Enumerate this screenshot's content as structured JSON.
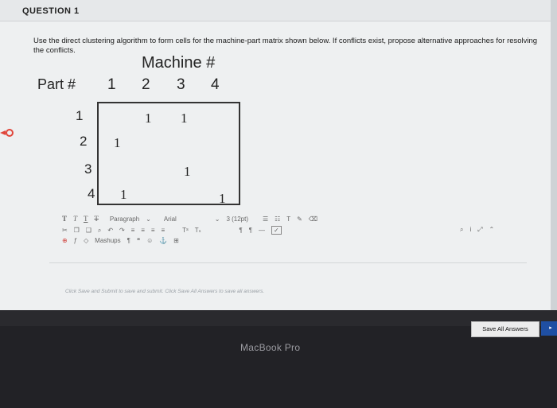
{
  "question": {
    "title": "QUESTION 1",
    "text": "Use the direct clustering algorithm to form cells for the machine-part matrix shown below. If conflicts exist, propose alternative approaches for resolving the conflicts."
  },
  "matrix": {
    "machine_label": "Machine #",
    "part_label": "Part #",
    "columns": [
      "1",
      "2",
      "3",
      "4"
    ],
    "rows": [
      "1",
      "2",
      "3",
      "4"
    ],
    "cells": [
      {
        "row": "1",
        "col": "2",
        "value": "1"
      },
      {
        "row": "1",
        "col": "3",
        "value": "1"
      },
      {
        "row": "2",
        "col": "1",
        "value": "1"
      },
      {
        "row": "3",
        "col": "3",
        "value": "1"
      },
      {
        "row": "4",
        "col": "1",
        "value": "1"
      },
      {
        "row": "4",
        "col": "4",
        "value": "1"
      }
    ]
  },
  "toolbar": {
    "format_buttons": [
      "T",
      "T",
      "T",
      "T"
    ],
    "paragraph": "Paragraph",
    "font": "Arial",
    "size": "3 (12pt)",
    "mashups": "Mashups"
  },
  "editor": {
    "hint": "Click Save and Submit to save and submit. Click Save All Answers to save all answers."
  },
  "actions": {
    "save_all_label": "Save All Answers"
  },
  "device": {
    "label": "MacBook Pro"
  }
}
